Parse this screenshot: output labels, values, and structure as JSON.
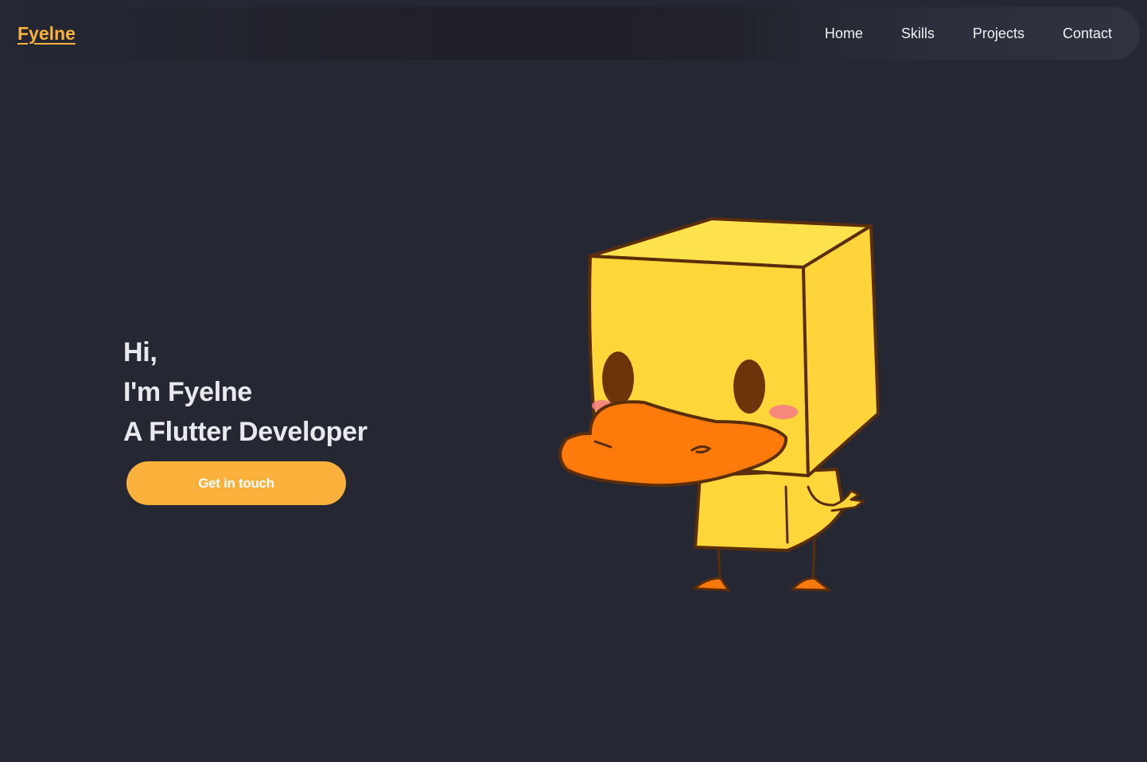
{
  "navbar": {
    "logo": "Fyelne",
    "links": [
      {
        "label": "Home"
      },
      {
        "label": "Skills"
      },
      {
        "label": "Projects"
      },
      {
        "label": "Contact"
      }
    ]
  },
  "hero": {
    "lines": [
      "Hi,",
      "I'm Fyelne",
      "A Flutter Developer"
    ],
    "cta_label": "Get in touch",
    "illustration": "box-duck-mascot"
  },
  "colors": {
    "background": "#252733",
    "accent": "#fbb13c",
    "text": "#eaeaee",
    "duck_body": "#fdd73a",
    "duck_beak": "#fd7a0b",
    "duck_outline": "#5a2e0a"
  }
}
